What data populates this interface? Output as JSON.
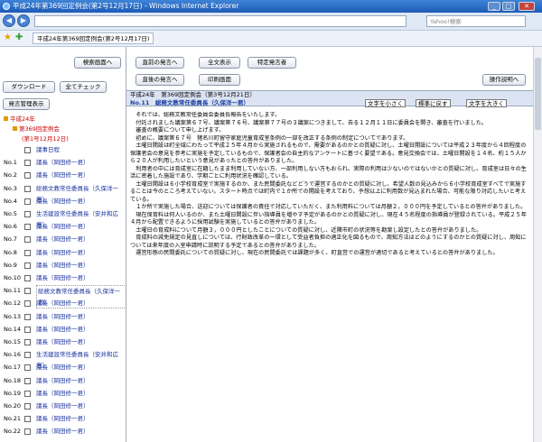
{
  "window": {
    "title": "平成24年第369回定例会(第2号12月17日) - Windows Internet Explorer",
    "minimize": "_",
    "maximize": "□",
    "close": "✕"
  },
  "browser": {
    "search_placeholder": "Yahoo!検索",
    "tab_title": "平成24年第369回定例会(第2号12月17日)",
    "back_glyph": "◀",
    "forward_glyph": "▶"
  },
  "left": {
    "search_screen_label": "検索画面へ",
    "download_label": "ダウンロード",
    "check_all_label": "全てチェック",
    "speaker_list_label": "発言管理表示",
    "tree": {
      "year": "平成24年",
      "session": "第369回定例会",
      "date": "(第1号12月12日)"
    },
    "rows": [
      {
        "no": "",
        "label": "議事日程"
      },
      {
        "no": "No.1",
        "label": "議長（岡田修一君）"
      },
      {
        "no": "No.2",
        "label": "議長（岡田修一君）"
      },
      {
        "no": "No.3",
        "label": "総務文教常任委員長（久保洋一君）"
      },
      {
        "no": "No.4",
        "label": "議長（岡田修一君）"
      },
      {
        "no": "No.5",
        "label": "生活建設常任委員長（安井和広君）"
      },
      {
        "no": "No.6",
        "label": "議長（岡田修一君）"
      },
      {
        "no": "No.7",
        "label": "議長（岡田修一君）"
      },
      {
        "no": "No.8",
        "label": "議長（岡田修一君）"
      },
      {
        "no": "No.9",
        "label": "議長（岡田修一君）"
      },
      {
        "no": "No.10",
        "label": "議長（岡田修一君）"
      },
      {
        "no": "No.11",
        "label": "総務文教常任委員長（久保洋一君）"
      },
      {
        "no": "No.12",
        "label": "議長（岡田修一君）"
      },
      {
        "no": "No.13",
        "label": "議長（岡田修一君）"
      },
      {
        "no": "No.14",
        "label": "議長（岡田修一君）"
      },
      {
        "no": "No.15",
        "label": "議長（岡田修一君）"
      },
      {
        "no": "No.16",
        "label": "生活建設常任委員長（安井和広君）"
      },
      {
        "no": "No.17",
        "label": "議長（岡田修一君）"
      },
      {
        "no": "No.18",
        "label": "議長（岡田修一君）"
      },
      {
        "no": "No.19",
        "label": "議長（岡田修一君）"
      },
      {
        "no": "No.20",
        "label": "議長（岡田修一君）"
      },
      {
        "no": "No.21",
        "label": "議長（岡田修一君）"
      },
      {
        "no": "No.22",
        "label": "議長（岡田修一君）"
      }
    ]
  },
  "right": {
    "prev_speech_label": "直前の発言へ",
    "full_text_label": "全文表示",
    "specific_speaker_label": "特定発言者",
    "next_speech_label": "直後の発言へ",
    "print_screen_label": "印刷画面",
    "help_label": "操作説明へ",
    "session_heading": "平成24年　第369回定例会（第3号12月21日）",
    "speaker_heading": "No.11　総務文教常任委員長（久保洋一君）",
    "font_smaller": "文字を小さく",
    "font_reset": "標準に戻す",
    "font_larger": "文字を大きく",
    "paragraphs": [
      "それでは、総務文教常任委員会委員長報告をいたします。",
      "付託されました議案第６７号、議案第７６号、議案第７７号の３議案につきまして、去る１２月１１日に委員会を開き、審査を行いました。",
      "審査の概要について申し上げます。",
      "初めに、議案第６７号　猪名川町留守家庭児童育成室条例の一部を改正する条例の制定についてであります。",
      "土曜日開設は町全域にわたって平成２５年４月から実施されるもので、需要があるのかとの質疑に対し、土曜日開設については平成２３年度から４回程度の保護者会の意見を参考に実施を予定しているもので、保護者会の自主的なアンケートに基づく要望である。意見交換会では、土曜日開設を１４名、約１５人から２０人が利用したいという意見があったとの答弁がありました。",
      "利用者の中には育成室に在籍したまま利用していない方、一部利用しない方もおられ、実際の利用は少ないのではないかとの質疑に対し、育成室は日々の生活に密着した施設であり、学期ごとに利用状況を確認している。",
      "土曜日開設は６小学校育成室で実施するのか、また民間委託などどうで運営するのかとの質疑に対し、希望人数の見込みから６小学校育成室すべてで実施することは今のところ考えていない。スタート時点では町内で１か所での開設を考えており、予想以上に利用数が見込まれた場合、可能な限り対応したいと考えている。",
      "１か所で実施した場合、送迎については保護者の責任で対応していただく、また利用料については月額２，０００円を予定しているとの答弁がありました。",
      "現在保育料は何人いるのか、また土曜日開設に伴い指導員を増やす予定があるのかとの質疑に対し、現在４５名程度の指導員が登録されている。平成２５年４月から配置できるように採用試験を実施しているとの答弁がありました。",
      "土曜日の育成料について月額３，０００円としたことについての質疑に対し、近隣市町の状況等を勘案し設定したとの答弁がありました。",
      "育成料の減免規定の見直しについては、行財政改革の一環として受益者負担の適正化を図るもので、周知方法はどのようにするのかとの質疑に対し、周知については来年度の入室申請時に説明する予定であるとの答弁がありました。",
      "運営形態の民間委託についての質疑に対し、現在の民間委託では課題が多く、町直営での運営が適切であると考えているとの答弁がありました。"
    ]
  }
}
